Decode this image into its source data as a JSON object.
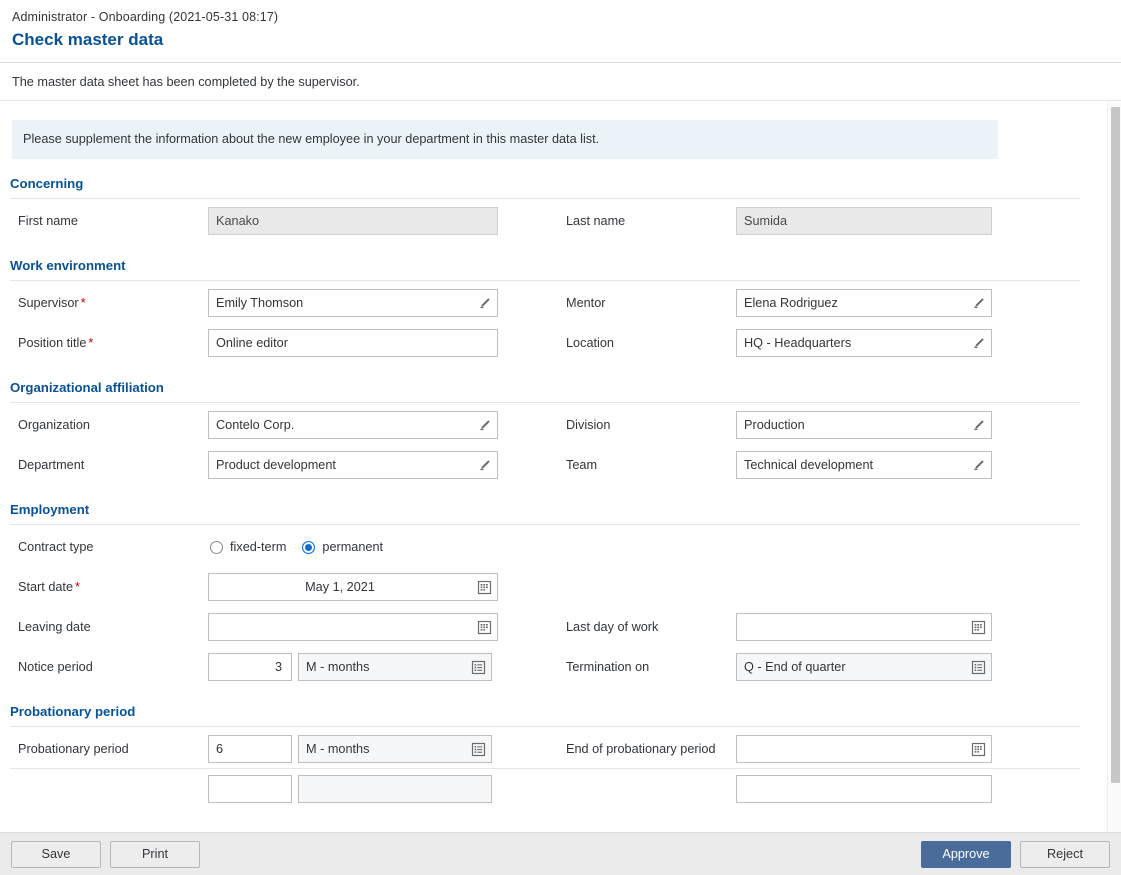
{
  "header": {
    "breadcrumb": "Administrator - Onboarding (2021-05-31 08:17)",
    "title": "Check master data",
    "subtitle": "The master data sheet has been completed by the supervisor.",
    "message": "Please supplement the information about the new employee in your department in this master data list."
  },
  "sections": {
    "concerning": {
      "title": "Concerning",
      "first_name_label": "First name",
      "first_name_value": "Kanako",
      "last_name_label": "Last name",
      "last_name_value": "Sumida"
    },
    "work_environment": {
      "title": "Work environment",
      "supervisor_label": "Supervisor",
      "supervisor_value": "Emily Thomson",
      "mentor_label": "Mentor",
      "mentor_value": "Elena Rodriguez",
      "position_title_label": "Position title",
      "position_title_value": "Online editor",
      "location_label": "Location",
      "location_value": "HQ - Headquarters"
    },
    "organizational_affiliation": {
      "title": "Organizational affiliation",
      "organization_label": "Organization",
      "organization_value": "Contelo Corp.",
      "division_label": "Division",
      "division_value": "Production",
      "department_label": "Department",
      "department_value": "Product development",
      "team_label": "Team",
      "team_value": "Technical development"
    },
    "employment": {
      "title": "Employment",
      "contract_type_label": "Contract type",
      "contract_options": [
        {
          "label": "fixed-term",
          "selected": false
        },
        {
          "label": "permanent",
          "selected": true
        }
      ],
      "start_date_label": "Start date",
      "start_date_value": "May 1, 2021",
      "leaving_date_label": "Leaving date",
      "leaving_date_value": "",
      "last_day_label": "Last day of work",
      "last_day_value": "",
      "notice_period_label": "Notice period",
      "notice_period_value": "3",
      "notice_period_unit": "M - months",
      "termination_on_label": "Termination on",
      "termination_on_value": "Q - End of quarter"
    },
    "probationary_period": {
      "title": "Probationary period",
      "probationary_label": "Probationary period",
      "probationary_value": "6",
      "probationary_unit": "M - months",
      "end_label": "End of probationary period",
      "end_value": ""
    }
  },
  "required_marker": "*",
  "footer": {
    "save": "Save",
    "print": "Print",
    "approve": "Approve",
    "reject": "Reject"
  },
  "colors": {
    "accent_blue": "#0a5191",
    "primary_button": "#4a6c9b",
    "required_red": "#bb0000",
    "message_strip": "#ebf3f9",
    "radio_selected": "#0a6ed1"
  }
}
